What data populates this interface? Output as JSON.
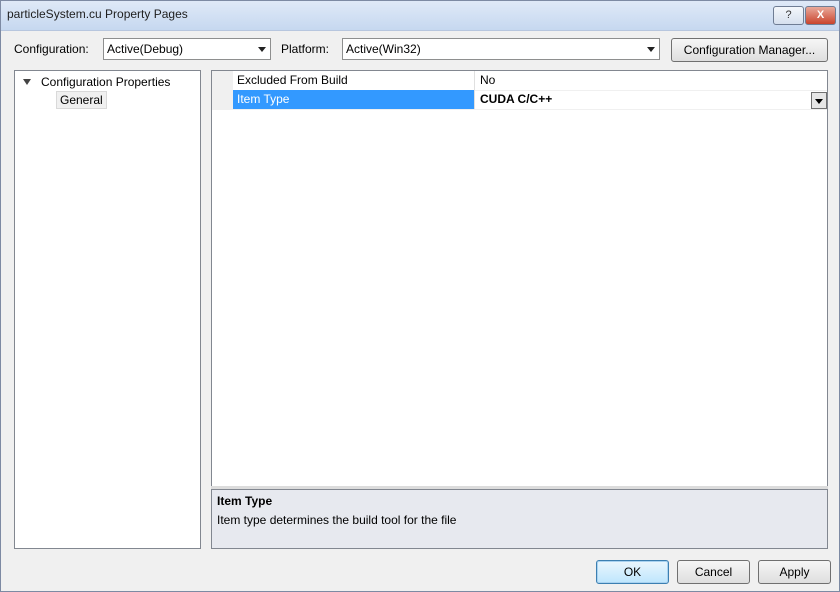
{
  "window": {
    "title": "particleSystem.cu Property Pages",
    "help_glyph": "?",
    "close_glyph": "X"
  },
  "toolbar": {
    "configuration_label": "Configuration:",
    "configuration_value": "Active(Debug)",
    "platform_label": "Platform:",
    "platform_value": "Active(Win32)",
    "config_manager_label": "Configuration Manager..."
  },
  "tree": {
    "root_label": "Configuration Properties",
    "child_label": "General"
  },
  "grid": {
    "rows": [
      {
        "name": "Excluded From Build",
        "value": "No"
      },
      {
        "name": "Item Type",
        "value": "CUDA C/C++"
      }
    ]
  },
  "description": {
    "title": "Item Type",
    "text": "Item type determines the build tool for the file"
  },
  "buttons": {
    "ok": "OK",
    "cancel": "Cancel",
    "apply": "Apply"
  }
}
